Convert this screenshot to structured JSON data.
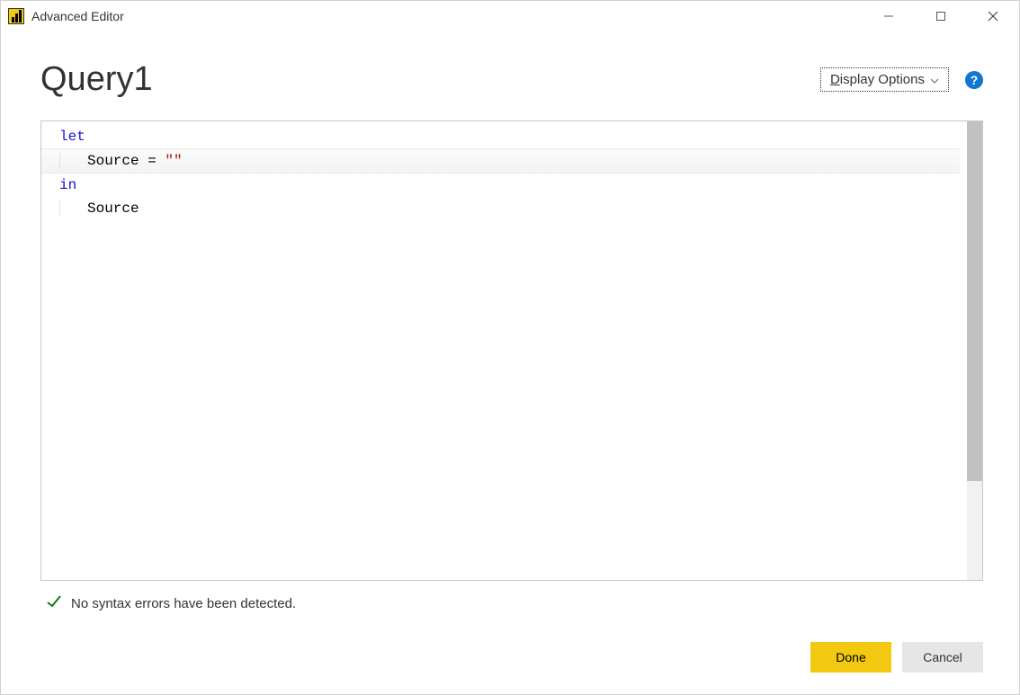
{
  "window": {
    "title": "Advanced Editor"
  },
  "header": {
    "query_name": "Query1",
    "display_options_label": "Display Options",
    "display_options_underline_char": "D"
  },
  "editor": {
    "code": {
      "line1_keyword": "let",
      "line2_indent_text": "Source = ",
      "line2_string": "\"\"",
      "line3_keyword": "in",
      "line4_indent_text": "Source"
    }
  },
  "status": {
    "message": "No syntax errors have been detected."
  },
  "buttons": {
    "done": "Done",
    "cancel": "Cancel"
  }
}
